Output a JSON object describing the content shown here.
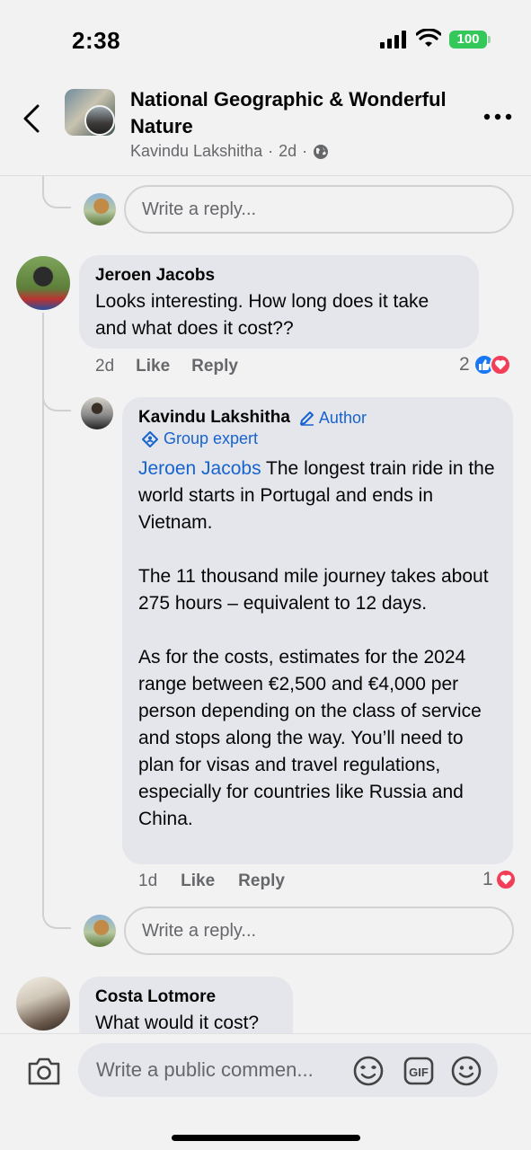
{
  "status_bar": {
    "time": "2:38",
    "battery": "100"
  },
  "header": {
    "title": "National Geographic & Wonderful Nature",
    "author": "Kavindu Lakshitha",
    "age": "2d",
    "separator": "·",
    "back_icon": "chevron-left-icon",
    "more_icon": "more-horizontal-icon"
  },
  "reply_box_top": {
    "placeholder": "Write a reply..."
  },
  "comments": [
    {
      "author": "Jeroen Jacobs",
      "text": "Looks interesting. How long does it take and what does it cost??",
      "time": "2d",
      "like_label": "Like",
      "reply_label": "Reply",
      "reaction_count": "2"
    }
  ],
  "reply": {
    "author": "Kavindu Lakshitha",
    "author_badge": "Author",
    "expert_badge": "Group expert",
    "mention": "Jeroen Jacobs",
    "text_p1": " The longest train ride in the world starts in Portugal and ends in Vietnam.",
    "text_p2": "The 11 thousand mile journey takes about 275 hours – equivalent to 12 days.",
    "text_p3": "As for the costs, estimates for the 2024 range between €2,500 and €4,000 per person depending on the class of service and stops along the way. You’ll need to plan for visas and travel regulations, especially for countries like Russia and China.",
    "time": "1d",
    "like_label": "Like",
    "reply_label": "Reply",
    "reaction_count": "1"
  },
  "reply_box_bottom": {
    "placeholder": "Write a reply..."
  },
  "next_comment": {
    "author": "Costa Lotmore",
    "text": "What would it cost?"
  },
  "composer": {
    "placeholder": "Write a public commen...",
    "camera_icon": "camera-icon",
    "sticker_icon": "sticker-icon",
    "gif_icon": "gif-icon",
    "emoji_icon": "emoji-icon"
  },
  "colors": {
    "background": "#f2f2f2",
    "bubble": "#e4e6eb",
    "link_blue": "#1763cf",
    "like_blue": "#1877f2",
    "love_red": "#f33e58",
    "battery_green": "#34c759"
  }
}
